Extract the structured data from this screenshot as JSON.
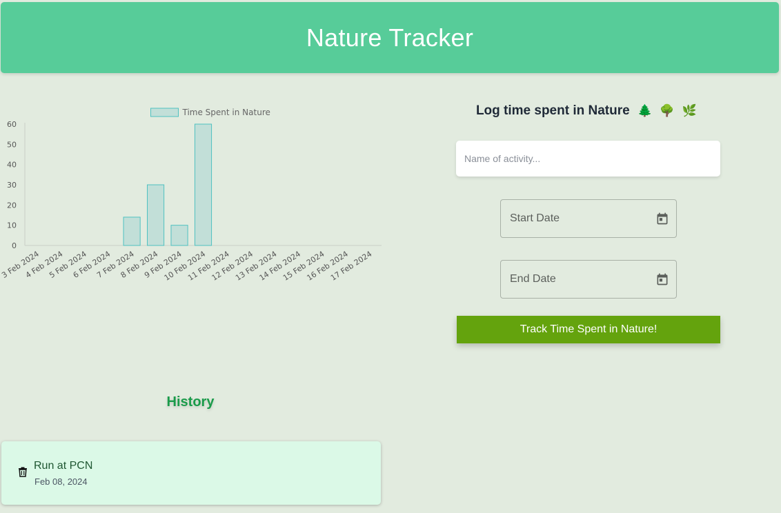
{
  "header": {
    "title": "Nature Tracker"
  },
  "chart_data": {
    "type": "bar",
    "legend": [
      "Time Spent in Nature"
    ],
    "categories": [
      "3 Feb 2024",
      "4 Feb 2024",
      "5 Feb 2024",
      "6 Feb 2024",
      "7 Feb 2024",
      "8 Feb 2024",
      "9 Feb 2024",
      "10 Feb 2024",
      "11 Feb 2024",
      "12 Feb 2024",
      "13 Feb 2024",
      "14 Feb 2024",
      "15 Feb 2024",
      "16 Feb 2024",
      "17 Feb 2024"
    ],
    "series": [
      {
        "name": "Time Spent in Nature",
        "values": [
          0,
          0,
          0,
          0,
          14,
          30,
          10,
          60,
          0,
          0,
          0,
          0,
          0,
          0,
          0
        ]
      }
    ],
    "yticks": [
      0,
      10,
      20,
      30,
      40,
      50,
      60
    ],
    "ylim": [
      0,
      60
    ],
    "bar_fill": "#c2dfd8",
    "bar_stroke": "#4fc1c1",
    "legend_position": "top"
  },
  "history": {
    "title": "History",
    "items": [
      {
        "name": "Run at PCN",
        "date": "Feb 08, 2024"
      }
    ]
  },
  "form": {
    "title": "Log time spent in Nature",
    "emojis": [
      "🌲",
      "🌳",
      "🌿"
    ],
    "activity_placeholder": "Name of activity...",
    "start_label": "Start Date",
    "end_label": "End Date",
    "submit_label": "Track Time Spent in Nature!"
  },
  "colors": {
    "header_bg": "#57cc99",
    "page_bg": "#e2ebdf",
    "button_bg": "#64a30d",
    "history_title": "#1a9b4a",
    "history_card_bg": "#dbf9e7"
  }
}
